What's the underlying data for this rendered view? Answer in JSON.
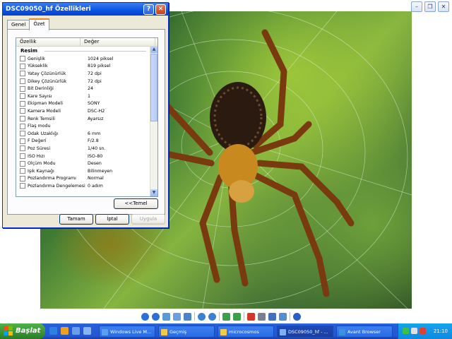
{
  "dialog": {
    "title": "DSC09050_hf Özellikleri",
    "tabs": [
      "Genel",
      "Özet"
    ],
    "active_tab": "Özet",
    "list_header": {
      "property": "Özellik",
      "value": "Değer"
    },
    "group_label": "Resim",
    "rows": [
      {
        "name": "Genişlik",
        "value": "1024 piksel"
      },
      {
        "name": "Yükseklik",
        "value": "819 piksel"
      },
      {
        "name": "Yatay Çözünürlük",
        "value": "72 dpi"
      },
      {
        "name": "Dikey Çözünürlük",
        "value": "72 dpi"
      },
      {
        "name": "Bit Derinliği",
        "value": "24"
      },
      {
        "name": "Kare Sayısı",
        "value": "1"
      },
      {
        "name": "Ekipman Modeli",
        "value": "SONY"
      },
      {
        "name": "Kamera Modeli",
        "value": "DSC-H2"
      },
      {
        "name": "Renk Temsili",
        "value": "Ayarsız"
      },
      {
        "name": "Flaş modu",
        "value": ""
      },
      {
        "name": "Odak Uzaklığı",
        "value": "6 mm"
      },
      {
        "name": "F Değeri",
        "value": "F/2.8"
      },
      {
        "name": "Poz Süresi",
        "value": "1/40 sn."
      },
      {
        "name": "ISO Hızı",
        "value": "ISO-80"
      },
      {
        "name": "Ölçüm Modu",
        "value": "Desen"
      },
      {
        "name": "Işık Kaynağı",
        "value": "Bilinmeyen"
      },
      {
        "name": "Pozlandırma Programı",
        "value": "Normal"
      },
      {
        "name": "Pozlandırma Dengelemesi",
        "value": "0 adım"
      }
    ],
    "basic_button": "<<Temel",
    "ok_button": "Tamam",
    "cancel_button": "İptal",
    "apply_button": "Uygula"
  },
  "taskbar": {
    "start_label": "Başlat",
    "tasks": [
      {
        "label": "Windows Live M...",
        "active": false,
        "color": "#5aa0f0"
      },
      {
        "label": "Geçmiş",
        "active": false,
        "color": "#f2c94c"
      },
      {
        "label": "microcosmos",
        "active": false,
        "color": "#f2c94c"
      },
      {
        "label": "DSC09050_hf - ...",
        "active": true,
        "color": "#7fb0f5"
      },
      {
        "label": "Avant Browser",
        "active": false,
        "color": "#3f8fe0"
      }
    ],
    "clock": "21:10"
  }
}
